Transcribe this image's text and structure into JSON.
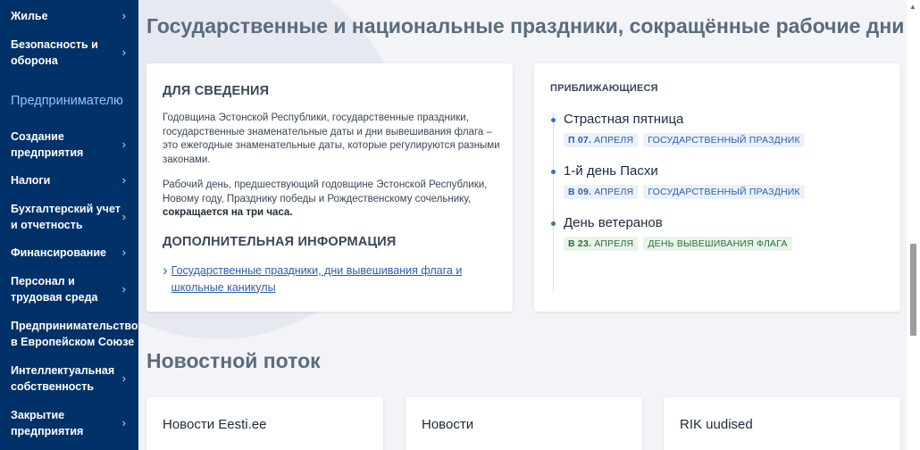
{
  "sidebar": {
    "items_top": [
      {
        "label": "Жилье"
      },
      {
        "label_l1": "Безопасность и",
        "label_l2": "оборона"
      }
    ],
    "section": "Предпринимателю",
    "items": [
      {
        "label_l1": "Создание",
        "label_l2": "предприятия"
      },
      {
        "label_l1": "Налоги",
        "label_l2": ""
      },
      {
        "label_l1": "Бухгалтерский учет",
        "label_l2": "и отчетность"
      },
      {
        "label_l1": "Финансирование",
        "label_l2": ""
      },
      {
        "label_l1": "Персонал и",
        "label_l2": "трудовая среда"
      },
      {
        "label_l1": "Предпринимательство",
        "label_l2": "в Европейском Союзе"
      },
      {
        "label_l1": "Интеллектуальная",
        "label_l2": "собственность"
      },
      {
        "label_l1": "Закрытие",
        "label_l2": "предприятия"
      }
    ],
    "chevron": "›"
  },
  "main": {
    "title": "Государственные и национальные праздники, сокращённые рабочие дни",
    "info": {
      "heading": "ДЛЯ СВЕДЕНИЯ",
      "para1": "Годовщина Эстонской Республики, государственные праздники, государственные знаменательные даты и дни вывешивания флага – это ежегодные знаменательные даты, которые регулируются разными законами.",
      "para2_prefix": "Рабочий день, предшествующий годовщине Эстонской Республики, Новому году, Празднику победы и Рождественскому сочельнику, ",
      "para2_bold": "сокращается на три часа.",
      "more_heading": "ДОПОЛНИТЕЛЬНАЯ ИНФОРМАЦИЯ",
      "link": "Государственные праздники, дни вывешивания флага и школьные каникулы"
    },
    "upcoming": {
      "title": "ПРИБЛИЖАЮЩИЕСЯ",
      "events": [
        {
          "name": "Страстная пятница",
          "date_bold": "П 07.",
          "date_rest": " АПРЕЛЯ",
          "type": "ГОСУДАРСТВЕННЫЙ ПРАЗДНИК",
          "type_color": "blue",
          "dot_color": "#2d73c6"
        },
        {
          "name": "1-й день Пасхи",
          "date_bold": "В 09.",
          "date_rest": " АПРЕЛЯ",
          "type": "ГОСУДАРСТВЕННЫЙ ПРАЗДНИК",
          "type_color": "blue",
          "dot_color": "#2d73c6"
        },
        {
          "name": "День ветеранов",
          "date_bold": "В 23.",
          "date_rest": " АПРЕЛЯ",
          "type": "ДЕНЬ ВЫВЕШИВАНИЯ ФЛАГА",
          "type_color": "green",
          "dot_color": "#3a8a4c"
        }
      ]
    },
    "feed": {
      "title": "Новостной поток",
      "cards": [
        "Новости Eesti.ee",
        "Новости",
        "RIK uudised"
      ]
    }
  },
  "scrollbar": {
    "up_arrow": "▲"
  }
}
